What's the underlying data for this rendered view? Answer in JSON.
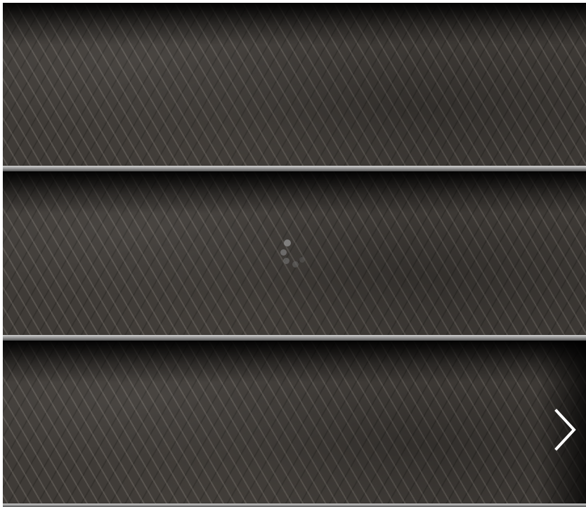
{
  "screen": {
    "name": "bookshelf-loading"
  },
  "shelves": [
    {
      "id": "shelf-1",
      "state": "empty"
    },
    {
      "id": "shelf-2",
      "state": "loading"
    },
    {
      "id": "shelf-3",
      "state": "empty"
    }
  ],
  "loading_indicator": {
    "icon": "loading-spinner-icon",
    "color": "#8f8f8f"
  },
  "navigation": {
    "next": {
      "icon": "chevron-right-icon",
      "color": "#ffffff"
    }
  }
}
